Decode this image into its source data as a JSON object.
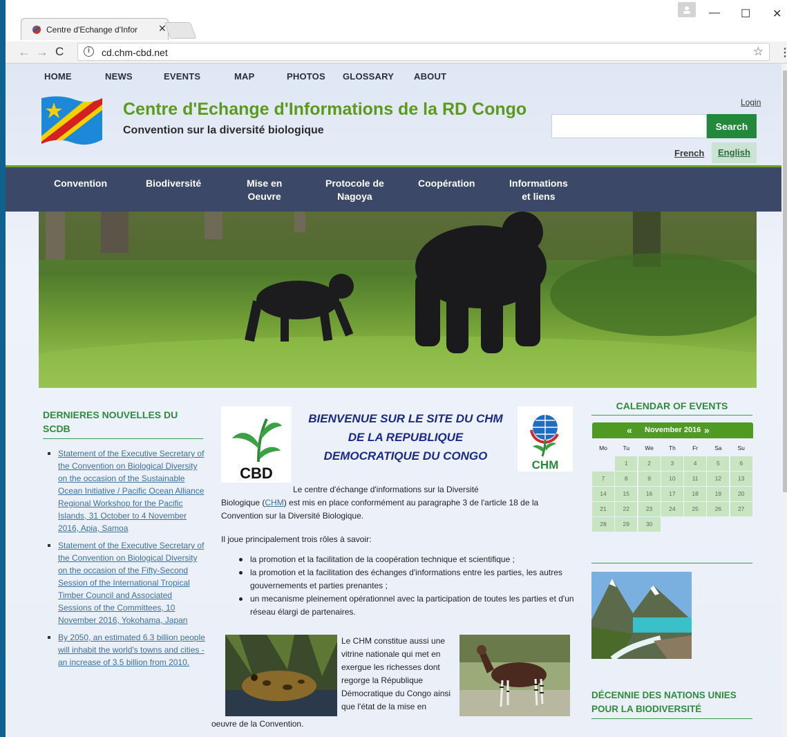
{
  "browser": {
    "tab_title": "Centre d'Echange d'Infor",
    "url": "cd.chm-cbd.net"
  },
  "topmenu": [
    "HOME",
    "NEWS",
    "EVENTS",
    "MAP",
    "PHOTOS",
    "GLOSSARY",
    "ABOUT"
  ],
  "header": {
    "title": "Centre d'Echange d'Informations de la RD Congo",
    "subtitle": "Convention sur la diversité biologique",
    "login": "Login",
    "search_button": "Search",
    "search_placeholder": "",
    "lang_french": "French",
    "lang_english": "English"
  },
  "mainnav": [
    {
      "line1": "Convention",
      "line2": ""
    },
    {
      "line1": "Biodiversité",
      "line2": ""
    },
    {
      "line1": "Mise en",
      "line2": "Oeuvre"
    },
    {
      "line1": "Protocole de",
      "line2": "Nagoya"
    },
    {
      "line1": "Coopération",
      "line2": ""
    },
    {
      "line1": "Informations",
      "line2": "et liens"
    }
  ],
  "news": {
    "heading": "DERNIERES NOUVELLES DU SCDB",
    "items": [
      "Statement of the Executive Secretary of the Convention on Biological Diversity on the occasion of the Sustainable Ocean Initiative / Pacific Ocean Alliance Regional Workshop for the Pacific Islands, 31 October to 4 November 2016, Apia, Samoa",
      "Statement of the Executive Secretary of the Convention on Biological Diversity on the occasion of the Fifty-Second Session of the International Tropical Timber Council and Associated Sessions of the Committees, 10 November 2016, Yokohama, Japan",
      "By 2050, an estimated 6.3 billion people will inhabit the world's towns and cities - an increase of 3.5 billion from 2010."
    ]
  },
  "welcome": {
    "line1": "BIENVENUE SUR LE SITE DU CHM",
    "line2": "DE LA REPUBLIQUE",
    "line3": "DEMOCRATIQUE DU CONGO",
    "cbd_logo_text": "CBD",
    "chm_logo_text": "CHM",
    "intro_lead": "Le centre d'échange d'informations sur la Diversité",
    "intro_pre": "Biologique (",
    "intro_link": "CHM",
    "intro_post": ") est mis en place conformément au paragraphe 3 de l'article 18 de la Convention  sur la Diversité Biologique.",
    "roles_title": "Il joue principalement trois rôles à savoir:",
    "roles": [
      "la promotion et la facilitation de la coopération technique et scientifique ;",
      "la promotion et la facilitation des échanges d'informations entre les parties, les autres gouvernements et parties prenantes ;",
      "un mecanisme pleinement opérationnel avec la participation de toutes les parties et d'un réseau élargi de partenaires."
    ],
    "chm_paragraph": "Le CHM constitue aussi une vitrine nationale qui met en exergue les richesses dont regorge la République Démocratique du Congo ainsi que l'état de la mise en",
    "chm_paragraph_tail": "oeuvre de la Convention."
  },
  "calendar": {
    "title": "CALENDAR OF EVENTS",
    "prev": "«",
    "next": "»",
    "month": "November 2016",
    "weekdays": [
      "Mo",
      "Tu",
      "We",
      "Th",
      "Fr",
      "Sa",
      "Su"
    ],
    "weeks": [
      [
        "",
        "1",
        "2",
        "3",
        "4",
        "5",
        "6"
      ],
      [
        "7",
        "8",
        "9",
        "10",
        "11",
        "12",
        "13"
      ],
      [
        "14",
        "15",
        "16",
        "17",
        "18",
        "19",
        "20"
      ],
      [
        "21",
        "22",
        "23",
        "24",
        "25",
        "26",
        "27"
      ],
      [
        "28",
        "29",
        "30",
        "",
        "",
        "",
        ""
      ]
    ]
  },
  "decade": {
    "title": "DÉCENNIE DES NATIONS UNIES POUR LA BIODIVERSITÉ"
  },
  "colors": {
    "accent_green": "#5c9a1c",
    "nav_bg": "#3c4867",
    "heading_green": "#2e8a3d",
    "link_blue": "#3b6fa0",
    "welcome_blue": "#1a2a8a"
  }
}
